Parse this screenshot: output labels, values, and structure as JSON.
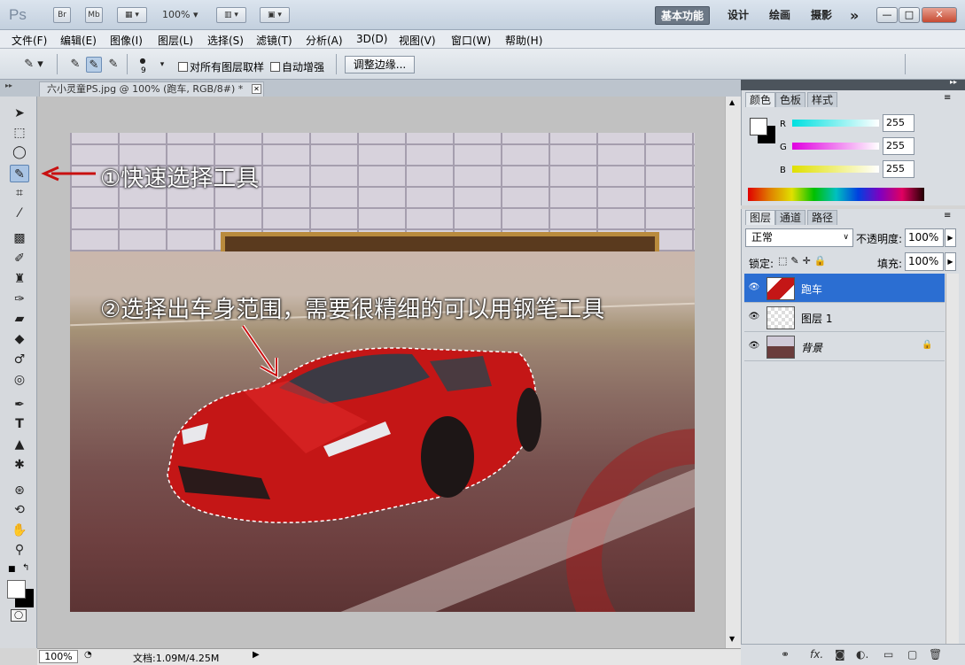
{
  "app": {
    "logo": "Ps",
    "bridge": "Br",
    "minibridge": "Mb",
    "zoom": "100%"
  },
  "workspace": {
    "items": [
      "基本功能",
      "设计",
      "绘画",
      "摄影"
    ],
    "more": "»"
  },
  "window": {
    "min": "—",
    "max": "□",
    "close": "✕"
  },
  "menu": [
    "文件(F)",
    "编辑(E)",
    "图像(I)",
    "图层(L)",
    "选择(S)",
    "滤镜(T)",
    "分析(A)",
    "3D(D)",
    "视图(V)",
    "窗口(W)",
    "帮助(H)"
  ],
  "options": {
    "brush_size": "9",
    "sample_all": "对所有图层取样",
    "auto_enhance": "自动增强",
    "refine_edge": "调整边缘..."
  },
  "document": {
    "tab_title": "六小灵童PS.jpg @ 100% (跑车, RGB/8#) *",
    "close": "✕"
  },
  "annotations": {
    "step1": "①快速选择工具",
    "step2": "②选择出车身范围，需要很精细的可以用钢笔工具"
  },
  "status": {
    "zoom": "100%",
    "doc": "文档:1.09M/4.25M"
  },
  "color_panel": {
    "tabs": [
      "颜色",
      "色板",
      "样式"
    ],
    "R": "R",
    "G": "G",
    "B": "B",
    "r_val": "255",
    "g_val": "255",
    "b_val": "255"
  },
  "layers_panel": {
    "tabs": [
      "图层",
      "通道",
      "路径"
    ],
    "blend": "正常",
    "opacity_label": "不透明度:",
    "opacity": "100%",
    "lock_label": "锁定:",
    "fill_label": "填充:",
    "fill": "100%",
    "layers": [
      {
        "name": "跑车",
        "selected": true
      },
      {
        "name": "图层 1",
        "selected": false
      },
      {
        "name": "背景",
        "selected": false
      }
    ]
  },
  "colors": {
    "accent": "#2b6ed2",
    "car": "#c81818"
  }
}
